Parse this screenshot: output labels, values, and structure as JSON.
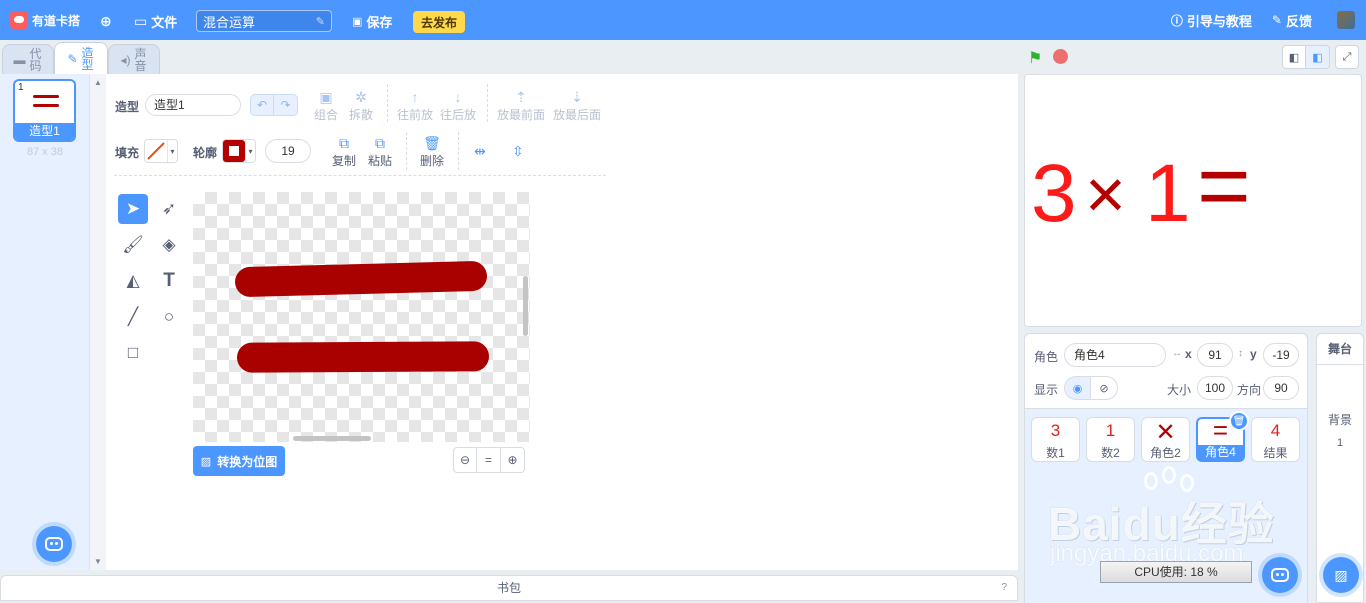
{
  "menubar": {
    "logo_text": "有道卡搭",
    "file_label": "文件",
    "project_title": "混合运算",
    "save_label": "保存",
    "publish_label": "去发布",
    "guide_label": "引导与教程",
    "feedback_label": "反馈"
  },
  "tabs": [
    {
      "label": "代码",
      "icon": "code-icon"
    },
    {
      "label": "造型",
      "icon": "brush-icon",
      "active": true
    },
    {
      "label": "声音",
      "icon": "speaker-icon"
    }
  ],
  "costume_list": {
    "items": [
      {
        "number": "1",
        "name": "造型1",
        "size": "87 x 38"
      }
    ]
  },
  "paint_editor": {
    "costume_label": "造型",
    "costume_name": "造型1",
    "actions_top": [
      {
        "label": "组合",
        "icon": "group-icon"
      },
      {
        "label": "拆散",
        "icon": "ungroup-icon"
      },
      {
        "label": "往前放",
        "icon": "forward-icon"
      },
      {
        "label": "往后放",
        "icon": "backward-icon"
      },
      {
        "label": "放最前面",
        "icon": "front-icon"
      },
      {
        "label": "放最后面",
        "icon": "back-icon"
      }
    ],
    "fill_label": "填充",
    "outline_label": "轮廓",
    "outline_color": "#b40000",
    "stroke_width": "19",
    "actions_bottom": [
      {
        "label": "复制",
        "icon": "copy-icon"
      },
      {
        "label": "粘贴",
        "icon": "paste-icon"
      },
      {
        "label": "删除",
        "icon": "trash-icon"
      }
    ],
    "convert_label": "转换为位图",
    "shape_color": "#a90000"
  },
  "backpack": {
    "label": "书包"
  },
  "stage": {
    "tokens": [
      {
        "text": "3",
        "color": "#ff1a1a"
      },
      {
        "text": "×",
        "color": "#b40000"
      },
      {
        "text": "1",
        "color": "#ff1a1a"
      },
      {
        "text": "=",
        "color": "#b40000"
      }
    ]
  },
  "sprite_info": {
    "sprite_label": "角色",
    "sprite_name": "角色4",
    "x_label": "x",
    "x_value": "91",
    "y_label": "y",
    "y_value": "-19",
    "show_label": "显示",
    "size_label": "大小",
    "size_value": "100",
    "direction_label": "方向",
    "direction_value": "90"
  },
  "sprites": [
    {
      "glyph": "3",
      "name": "数1"
    },
    {
      "glyph": "1",
      "name": "数2"
    },
    {
      "glyph": "✕",
      "name": "角色2"
    },
    {
      "glyph": "=",
      "name": "角色4",
      "selected": true
    },
    {
      "glyph": "4",
      "name": "结果"
    }
  ],
  "watermark": {
    "main": "Baidu经验",
    "url": "jingyan.baidu.com"
  },
  "cpu": {
    "label": "CPU使用: 18 %"
  },
  "stage_selector": {
    "title": "舞台",
    "backdrop_label": "背景",
    "backdrop_count": "1"
  }
}
